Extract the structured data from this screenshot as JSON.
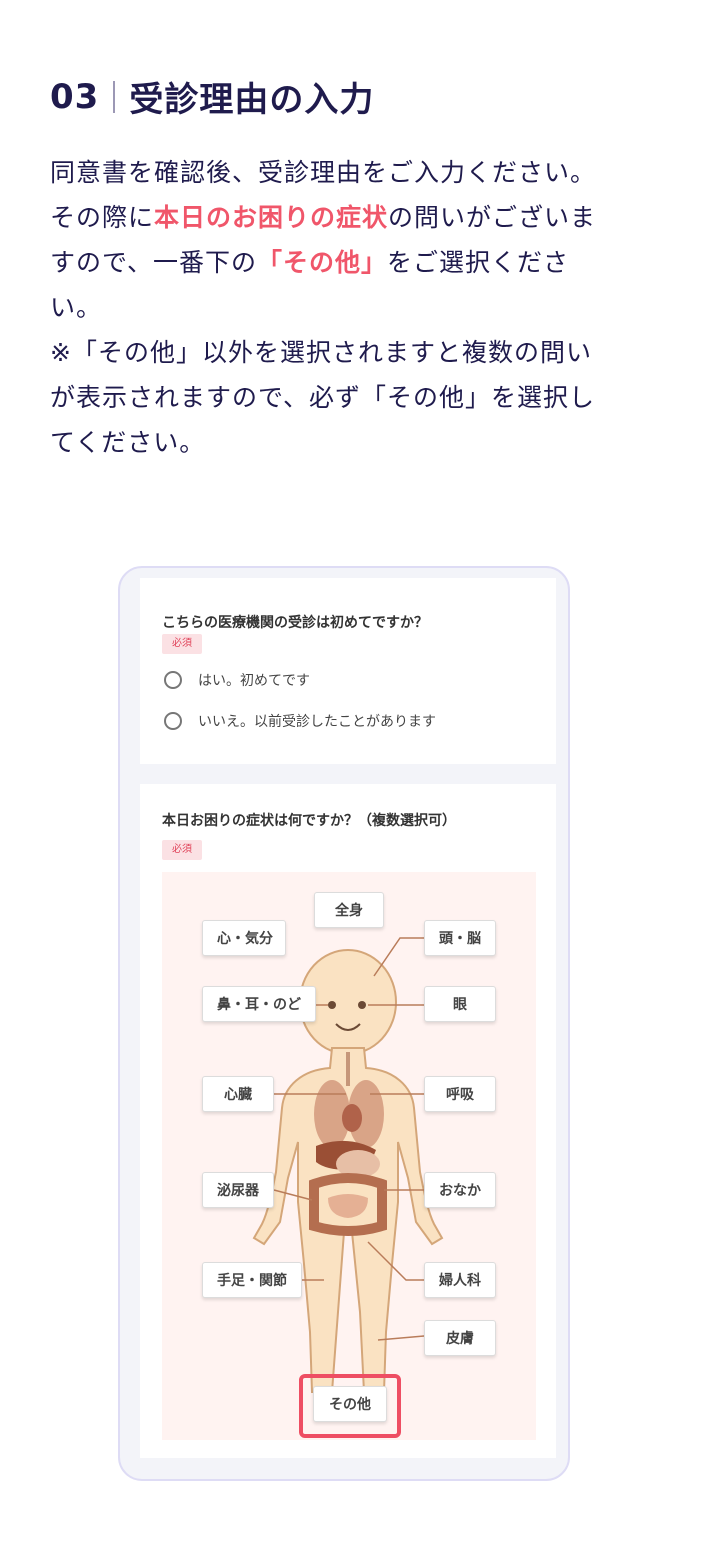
{
  "step": {
    "number": "03",
    "title": "受診理由の入力"
  },
  "intro": {
    "line1": "同意書を確認後、受診理由をご入力ください。",
    "line2a": "その際に",
    "line2hl": "本日のお困りの症状",
    "line2b": "の問いがございま",
    "line3a": "すので、一番下の",
    "line3hl": "「その他」",
    "line3b": "をご選択くださ",
    "line4": "い。",
    "line5": "※「その他」以外を選択されますと複数の問い",
    "line6": "が表示されますので、必ず「その他」を選択し",
    "line7": "てください。"
  },
  "form": {
    "q1": {
      "title": "こちらの医療機関の受診は初めてですか？",
      "badge": "必須",
      "options": [
        "はい。初めてです",
        "いいえ。以前受診したことがあります"
      ]
    },
    "q2": {
      "title": "本日お困りの症状は何ですか？（複数選択可）",
      "badge": "必須",
      "body_parts": {
        "whole_body": "全身",
        "mind": "心・気分",
        "head": "頭・脳",
        "nose_ear_throat": "鼻・耳・のど",
        "eye": "眼",
        "heart": "心臓",
        "breathing": "呼吸",
        "urinary": "泌尿器",
        "stomach": "おなか",
        "limbs_joints": "手足・関節",
        "gynecology": "婦人科",
        "skin": "皮膚",
        "other": "その他"
      }
    }
  },
  "colors": {
    "accent": "#f0566a",
    "text": "#1f1b4d",
    "diagram_bg": "#fff3f1"
  }
}
